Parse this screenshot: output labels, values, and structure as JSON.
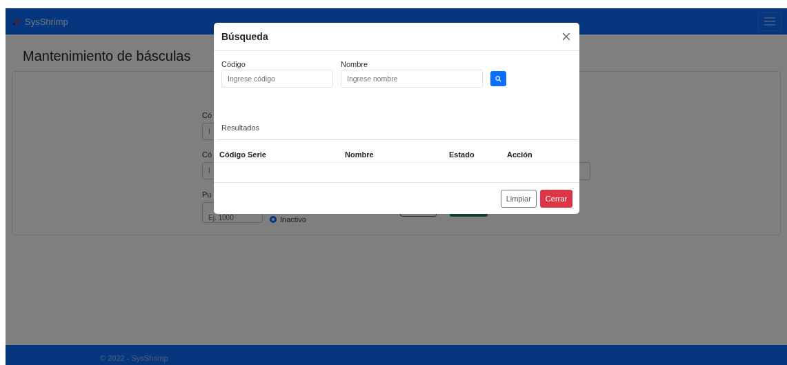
{
  "navbar": {
    "brand": "SysShrimp"
  },
  "page": {
    "title": "Mantenimiento de básculas"
  },
  "form": {
    "fields": [
      {
        "label": "Có",
        "placeholder": "I"
      },
      {
        "label": "Có",
        "placeholder": "I"
      },
      {
        "label": "Pu",
        "placeholder": "Ej. 1000"
      }
    ],
    "status_options": [
      {
        "label": "Inactivo",
        "selected": true
      }
    ]
  },
  "modal": {
    "title": "Búsqueda",
    "fields": [
      {
        "label": "Código",
        "placeholder": "Ingrese código"
      },
      {
        "label": "Nombre",
        "placeholder": "Ingrese nombre"
      }
    ],
    "results_label": "Resultados",
    "table": {
      "columns": [
        "Código Serie",
        "Nombre",
        "Estado",
        "Acción"
      ]
    },
    "buttons": [
      {
        "label": "Limpiar",
        "kind": "outline"
      },
      {
        "label": "Cerrar",
        "kind": "danger"
      }
    ]
  },
  "footer": {
    "text": "© 2022 - SysShrimp"
  }
}
